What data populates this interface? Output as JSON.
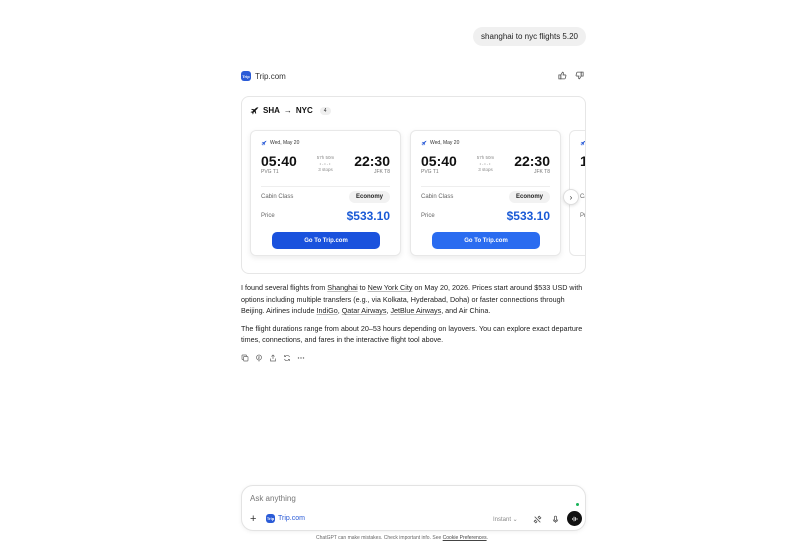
{
  "user_message": "shanghai to nyc flights 5.20",
  "app": {
    "name": "Trip.com",
    "logo_text": "Trip"
  },
  "widget": {
    "origin": "SHA",
    "destination": "NYC",
    "arrow": "→",
    "count": "4",
    "cards": [
      {
        "date": "Wed, May 20",
        "dep_time": "05:40",
        "dep_code": "PVG T1",
        "arr_time": "22:30",
        "arr_code": "JFK T8",
        "duration": "57h 50m",
        "stops": "3 stops",
        "cabin_label": "Cabin Class",
        "cabin_value": "Economy",
        "price_label": "Price",
        "price_value": "$533.10",
        "button_label": "Go To Trip.com"
      },
      {
        "date": "Wed, May 20",
        "dep_time": "05:40",
        "dep_code": "PVG T1",
        "arr_time": "22:30",
        "arr_code": "JFK T8",
        "duration": "57h 50m",
        "stops": "3 stops",
        "cabin_label": "Cabin Class",
        "cabin_value": "Economy",
        "price_label": "Price",
        "price_value": "$533.10",
        "button_label": "Go To Trip.com"
      },
      {
        "date": "",
        "dep_time": "1",
        "cabin_label": "Ca",
        "price_label": "Pr"
      }
    ]
  },
  "answer": {
    "p1_a": "I found several flights from ",
    "p1_shanghai": "Shanghai",
    "p1_b": " to ",
    "p1_nyc": "New York City",
    "p1_c": " on May 20, 2026. Prices start around $533 USD with options including multiple transfers (e.g., via Kolkata, Hyderabad, Doha) or faster connections through Beijing. Airlines include ",
    "p1_indigo": "IndiGo",
    "p1_d": ", ",
    "p1_qatar": "Qatar Airways",
    "p1_e": ", ",
    "p1_jetblue": "JetBlue Airways",
    "p1_f": ", and Air China.",
    "p2": "The flight durations range from about 20–53 hours depending on layovers. You can explore exact departure times, connections, and fares in the interactive flight tool above."
  },
  "composer": {
    "placeholder": "Ask anything",
    "tool_name": "Trip.com",
    "model": "Instant ⌄"
  },
  "disclaimer": {
    "text": "ChatGPT can make mistakes. Check important info. See ",
    "link": "Cookie Preferences",
    "end": "."
  },
  "colors": {
    "accent": "#1a5ad6",
    "button": "#1a52dd",
    "logo": "#2a5bd7"
  }
}
